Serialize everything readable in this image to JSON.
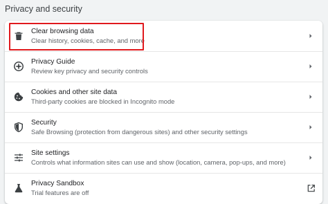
{
  "section": {
    "title": "Privacy and security"
  },
  "items": [
    {
      "label": "Clear browsing data",
      "sub": "Clear history, cookies, cache, and more",
      "icon": "trash-icon",
      "action": "chevron"
    },
    {
      "label": "Privacy Guide",
      "sub": "Review key privacy and security controls",
      "icon": "privacy-guide-icon",
      "action": "chevron"
    },
    {
      "label": "Cookies and other site data",
      "sub": "Third-party cookies are blocked in Incognito mode",
      "icon": "cookie-icon",
      "action": "chevron"
    },
    {
      "label": "Security",
      "sub": "Safe Browsing (protection from dangerous sites) and other security settings",
      "icon": "shield-icon",
      "action": "chevron"
    },
    {
      "label": "Site settings",
      "sub": "Controls what information sites can use and show (location, camera, pop-ups, and more)",
      "icon": "sliders-icon",
      "action": "chevron"
    },
    {
      "label": "Privacy Sandbox",
      "sub": "Trial features are off",
      "icon": "flask-icon",
      "action": "external-link"
    }
  ],
  "colors": {
    "highlight": "#e0191d",
    "background": "#f1f3f4",
    "card": "#ffffff"
  }
}
